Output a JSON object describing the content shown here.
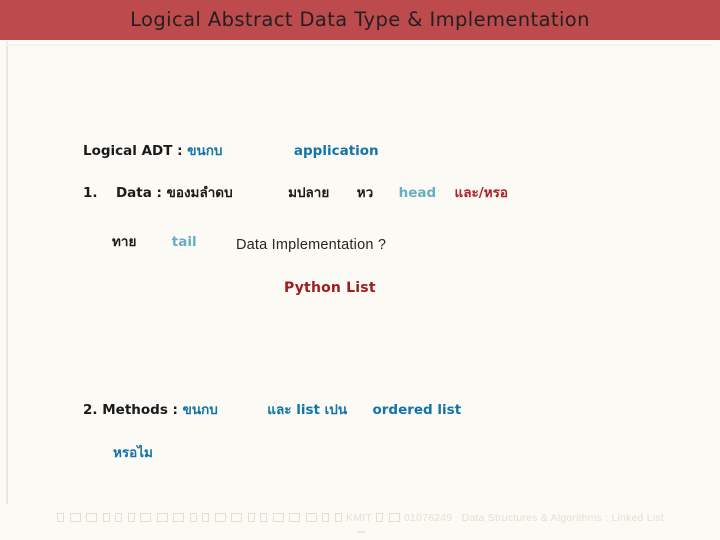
{
  "slide": {
    "title": "Logical Abstract Data Type  & Implementation",
    "title_bar_color": "#bd4b4d",
    "background_color": "#fbfaf5"
  },
  "content": {
    "logical_adt": {
      "label": "Logical ADT :",
      "thai_term": "ขนกบ",
      "english_term": "application"
    },
    "data_item": {
      "number": "1.",
      "label": "Data :",
      "thai_phrase_1": "ของมลำดบ",
      "thai_phrase_2": "มปลาย",
      "thai_phrase_3": "หว",
      "head_term": "head",
      "thai_conjunction": "และ/หรอ",
      "thai_tail": "ทาย",
      "tail_term": "tail"
    },
    "data_implementation_question": "Data Implementation ?",
    "python_list": "Python List",
    "methods_item": {
      "number": "2.",
      "label": "Methods :",
      "thai_phrase_1": "ขนกบ",
      "thai_phrase_2": "และ list เปน",
      "english_term": "ordered list",
      "thai_phrase_3": "หรอไม"
    }
  },
  "colors": {
    "blue": "#1274a8",
    "light_blue": "#67aec2",
    "red": "#b32025",
    "dark_red": "#9e1b1e",
    "black": "#1a1a1a",
    "footer_text": "#e4e0cf"
  },
  "footer": {
    "institution": "KMIT",
    "course_code": "01076249",
    "course_title": "Data Structures & Algorithms : Linked List"
  }
}
